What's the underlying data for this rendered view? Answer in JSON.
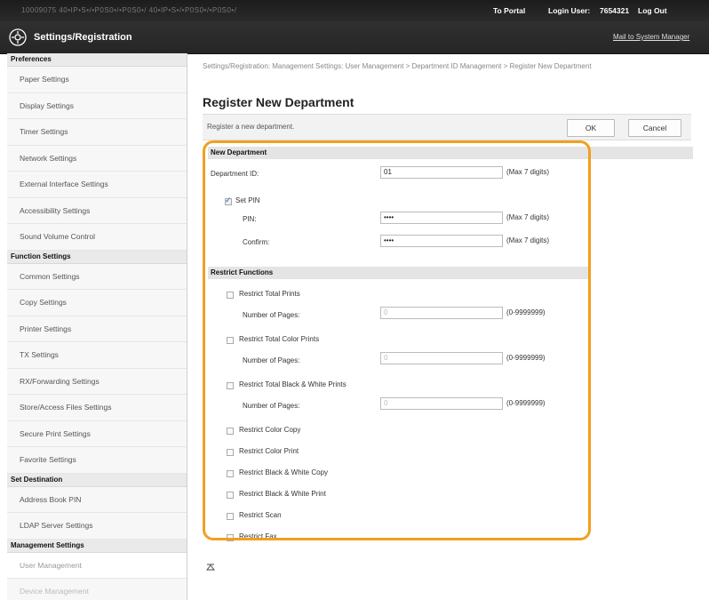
{
  "topbar": {
    "blurred_left": "10009075  40•IP•S•/•P0S0•/•P0S0•/  40•IP•S•/•P0S0•/•P0S0•/",
    "to_portal": "To Portal",
    "login_user_label": "Login User:",
    "login_user_value": "7654321",
    "logout": "Log Out"
  },
  "titlebar": {
    "title": "Settings/Registration",
    "mail_link": "Mail to System Manager"
  },
  "sidebar": {
    "sections": [
      {
        "head": "Preferences",
        "items": [
          "Paper Settings",
          "Display Settings",
          "Timer Settings",
          "Network Settings",
          "External Interface Settings",
          "Accessibility Settings",
          "Sound Volume Control"
        ]
      },
      {
        "head": "Function Settings",
        "items": [
          "Common Settings",
          "Copy Settings",
          "Printer Settings",
          "TX Settings",
          "RX/Forwarding Settings",
          "Store/Access Files Settings",
          "Secure Print Settings",
          "Favorite Settings"
        ]
      },
      {
        "head": "Set Destination",
        "items": [
          "Address Book PIN",
          "LDAP Server Settings"
        ]
      },
      {
        "head": "Management Settings",
        "items": [
          "User Management",
          "Device Management"
        ]
      }
    ]
  },
  "main": {
    "breadcrumb": "Settings/Registration: Management Settings: User Management > Department ID Management > Register New Department",
    "page_title": "Register New Department",
    "description": "Register a new department.",
    "ok_label": "OK",
    "cancel_label": "Cancel"
  },
  "new_department": {
    "heading": "New Department",
    "dept_id_label": "Department ID:",
    "dept_id_value": "01",
    "dept_id_hint": "(Max 7 digits)",
    "set_pin_label": "Set PIN",
    "set_pin_checked": true,
    "pin_label": "PIN:",
    "pin_value": "••••",
    "pin_hint": "(Max 7 digits)",
    "confirm_label": "Confirm:",
    "confirm_value": "••••",
    "confirm_hint": "(Max 7 digits)"
  },
  "restrict": {
    "heading": "Restrict Functions",
    "pages_label": "Number of Pages:",
    "pages_value": "0",
    "pages_hint": "(0-9999999)",
    "total_prints": "Restrict Total Prints",
    "total_color_prints": "Restrict Total Color Prints",
    "total_bw_prints": "Restrict Total Black & White Prints",
    "color_copy": "Restrict Color Copy",
    "color_print": "Restrict Color Print",
    "bw_copy": "Restrict Black & White Copy",
    "bw_print": "Restrict Black & White Print",
    "scan": "Restrict Scan",
    "fax": "Restrict Fax"
  },
  "colors": {
    "highlight": "#f0a020",
    "topbar": "#1c1c1c"
  }
}
